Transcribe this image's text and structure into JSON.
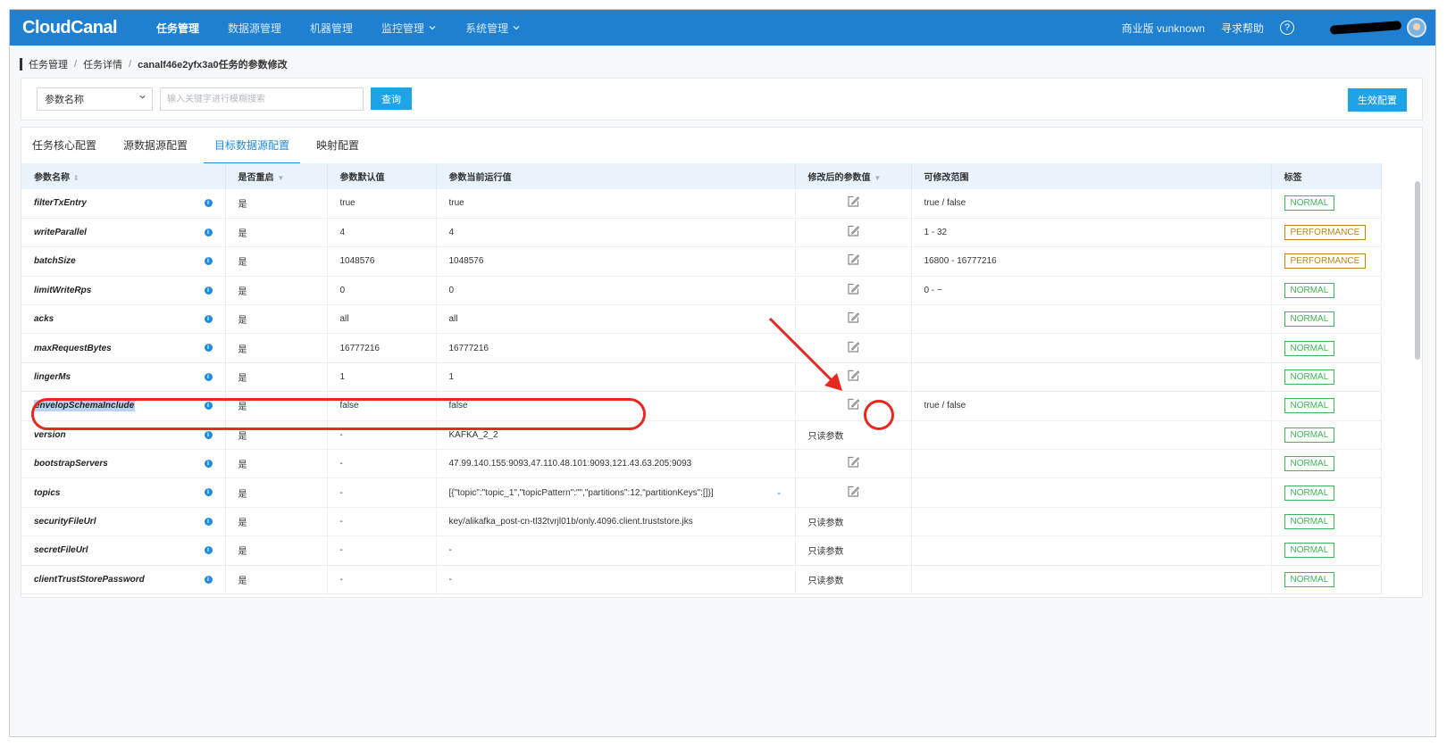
{
  "nav": {
    "logo": "CloudCanal",
    "items": [
      {
        "label": "任务管理",
        "active": true,
        "dropdown": false
      },
      {
        "label": "数据源管理",
        "active": false,
        "dropdown": false
      },
      {
        "label": "机器管理",
        "active": false,
        "dropdown": false
      },
      {
        "label": "监控管理",
        "active": false,
        "dropdown": true
      },
      {
        "label": "系统管理",
        "active": false,
        "dropdown": true
      }
    ],
    "edition": "商业版 vunknown",
    "help": "寻求帮助",
    "help_icon": "?"
  },
  "breadcrumb": {
    "items": [
      "任务管理",
      "任务详情"
    ],
    "current": "canalf46e2yfx3a0任务的参数修改",
    "separator": "/"
  },
  "search": {
    "select_value": "参数名称",
    "placeholder": "输入关键字进行模糊搜索",
    "query_label": "查询",
    "apply_label": "生效配置"
  },
  "tabs": [
    {
      "label": "任务核心配置",
      "active": false
    },
    {
      "label": "源数据源配置",
      "active": false
    },
    {
      "label": "目标数据源配置",
      "active": true
    },
    {
      "label": "映射配置",
      "active": false
    }
  ],
  "table": {
    "columns": [
      "参数名称",
      "是否重启",
      "参数默认值",
      "参数当前运行值",
      "修改后的参数值",
      "可修改范围",
      "标签"
    ],
    "rows": [
      {
        "name": "filterTxEntry",
        "restart": "是",
        "default": "true",
        "current": "true",
        "modified": "edit",
        "range": "true / false",
        "tag": "NORMAL"
      },
      {
        "name": "writeParallel",
        "restart": "是",
        "default": "4",
        "current": "4",
        "modified": "edit",
        "range": "1 - 32",
        "tag": "PERFORMANCE"
      },
      {
        "name": "batchSize",
        "restart": "是",
        "default": "1048576",
        "current": "1048576",
        "modified": "edit",
        "range": "16800 - 16777216",
        "tag": "PERFORMANCE"
      },
      {
        "name": "limitWriteRps",
        "restart": "是",
        "default": "0",
        "current": "0",
        "modified": "edit",
        "range": "0 - ~",
        "tag": "NORMAL"
      },
      {
        "name": "acks",
        "restart": "是",
        "default": "all",
        "current": "all",
        "modified": "edit",
        "range": "",
        "tag": "NORMAL"
      },
      {
        "name": "maxRequestBytes",
        "restart": "是",
        "default": "16777216",
        "current": "16777216",
        "modified": "edit",
        "range": "",
        "tag": "NORMAL"
      },
      {
        "name": "lingerMs",
        "restart": "是",
        "default": "1",
        "current": "1",
        "modified": "edit",
        "range": "",
        "tag": "NORMAL"
      },
      {
        "name": "envelopSchemaInclude",
        "restart": "是",
        "default": "false",
        "current": "false",
        "modified": "edit",
        "range": "true / false",
        "tag": "NORMAL",
        "highlighted": true
      },
      {
        "name": "version",
        "restart": "是",
        "default": "-",
        "current": "KAFKA_2_2",
        "modified": "只读参数",
        "range": "",
        "tag": "NORMAL"
      },
      {
        "name": "bootstrapServers",
        "restart": "是",
        "default": "-",
        "current": "47.99.140.155:9093,47.110.48.101:9093,121.43.63.205:9093",
        "modified": "edit",
        "range": "",
        "tag": "NORMAL"
      },
      {
        "name": "topics",
        "restart": "是",
        "default": "-",
        "current": "[{\"topic\":\"topic_1\",\"topicPattern\":\"\",\"partitions\":12,\"partitionKeys\":[]}]",
        "modified": "edit",
        "range": "",
        "tag": "NORMAL",
        "expandable": true
      },
      {
        "name": "securityFileUrl",
        "restart": "是",
        "default": "-",
        "current": "key/alikafka_post-cn-tl32tvrjl01b/only.4096.client.truststore.jks",
        "modified": "只读参数",
        "range": "",
        "tag": "NORMAL"
      },
      {
        "name": "secretFileUrl",
        "restart": "是",
        "default": "-",
        "current": "-",
        "modified": "只读参数",
        "range": "",
        "tag": "NORMAL"
      },
      {
        "name": "clientTrustStorePassword",
        "restart": "是",
        "default": "-",
        "current": "-",
        "modified": "只读参数",
        "range": "",
        "tag": "NORMAL"
      }
    ]
  },
  "colors": {
    "nav_bg": "#1f7fd0",
    "primary": "#1fa3e8",
    "tab_active": "#1f8ce0",
    "tag_normal": "#3fb55a",
    "tag_performance": "#b7861c",
    "annotation": "#e8271e"
  },
  "icons": {
    "edit": "edit-icon",
    "info": "info-icon",
    "sort": "sort-icon",
    "filter": "filter-icon",
    "help": "help-icon",
    "chevron": "chevron-down-icon"
  }
}
